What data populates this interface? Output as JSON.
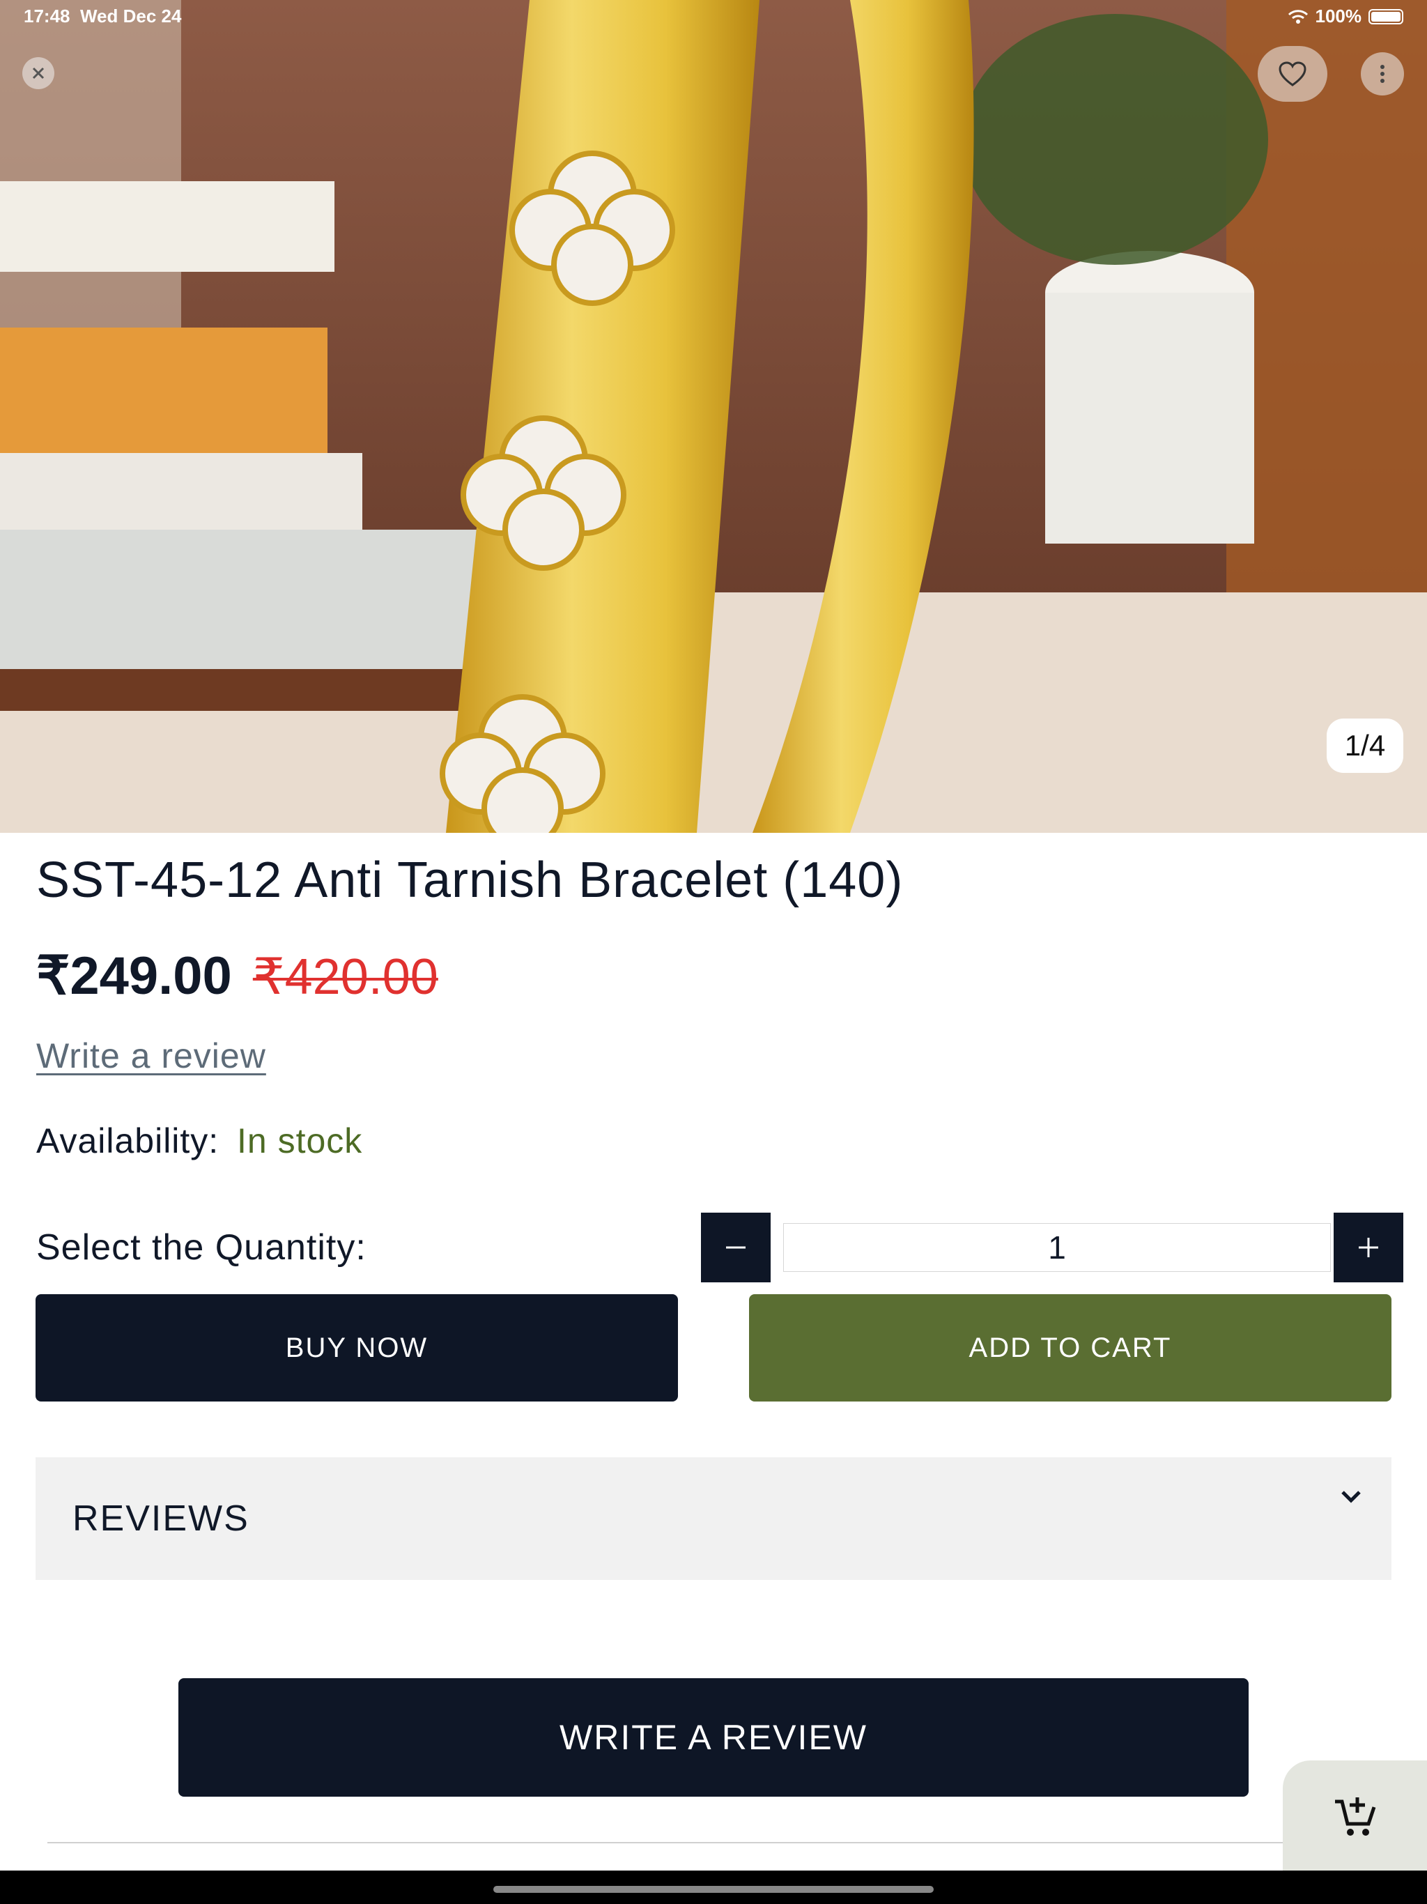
{
  "status_bar": {
    "time": "17:48",
    "date": "Wed Dec 24",
    "battery": "100%"
  },
  "gallery": {
    "counter": "1/4"
  },
  "product": {
    "title": "SST-45-12 Anti Tarnish Bracelet (140)",
    "price": "₹249.00",
    "original_price": "₹420.00",
    "write_review_link": "Write a review",
    "availability_label": "Availability:",
    "availability_value": "In stock",
    "quantity_label": "Select the Quantity:",
    "quantity_value": "1"
  },
  "actions": {
    "buy_now": "BUY NOW",
    "add_to_cart": "ADD TO CART"
  },
  "reviews": {
    "title": "REVIEWS",
    "write_review_button": "WRITE A REVIEW"
  },
  "colors": {
    "primary": "#0e1626",
    "accent_green": "#5a6e32",
    "sale_red": "#e0312f",
    "stock_green": "#4d6b25"
  },
  "icons": [
    "close-icon",
    "heart-icon",
    "more-vertical-icon",
    "minus-icon",
    "plus-icon",
    "chevron-down-icon",
    "add-to-cart-icon",
    "wifi-icon",
    "battery-icon"
  ]
}
